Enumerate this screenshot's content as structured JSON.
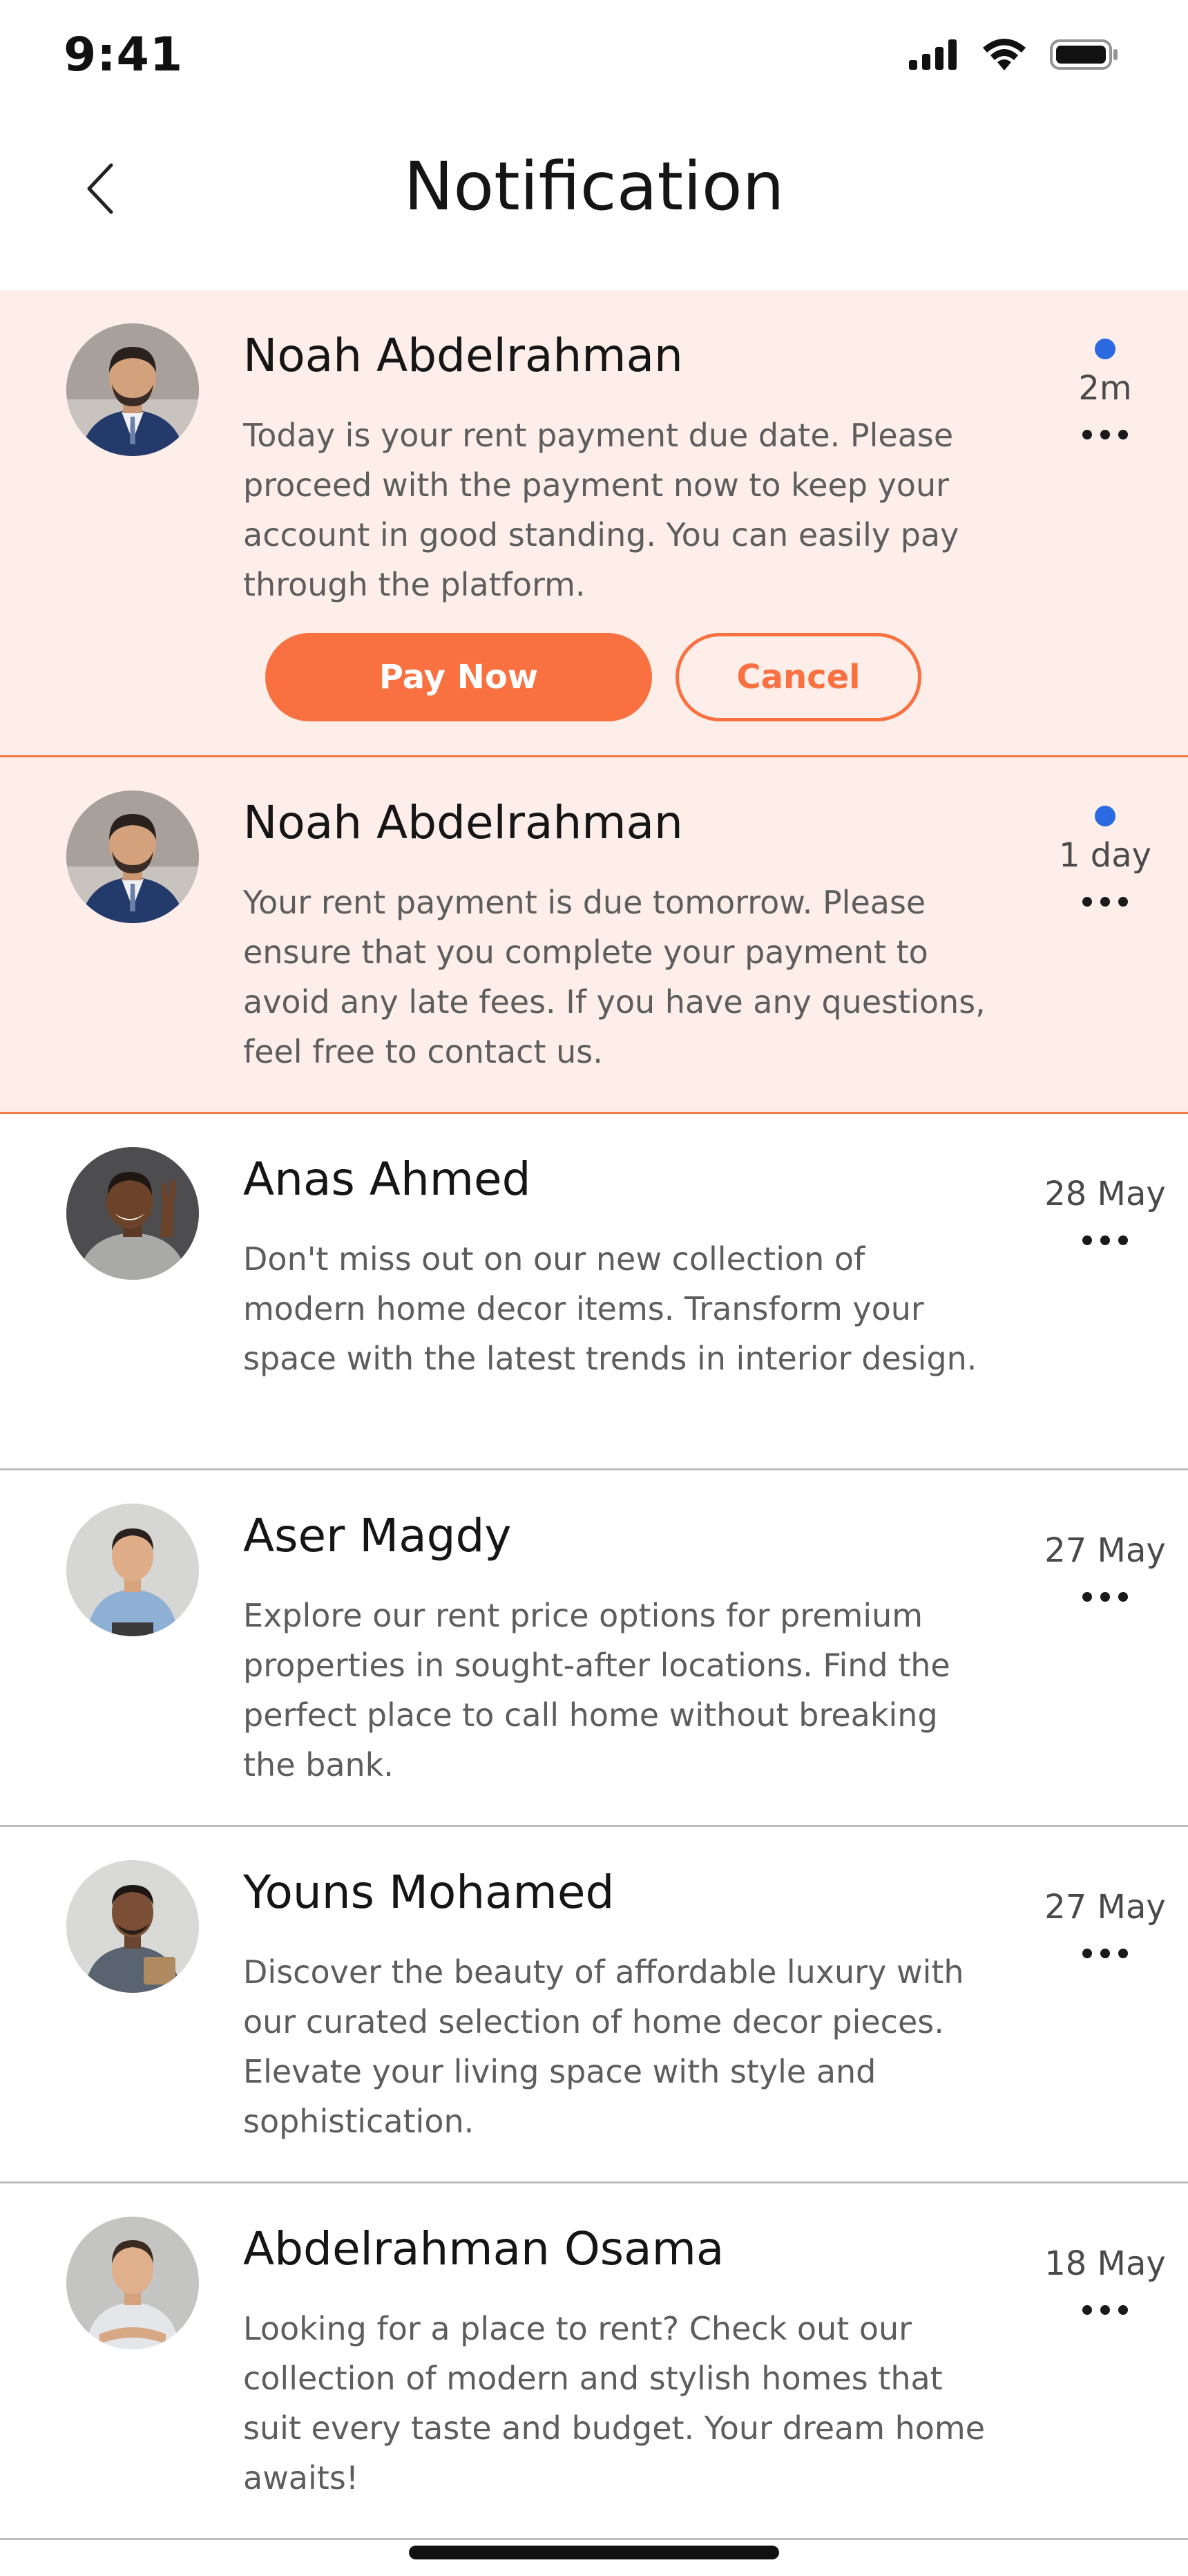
{
  "status_bar": {
    "time": "9:41",
    "icons": [
      "signal-icon",
      "wifi-icon",
      "battery-icon"
    ]
  },
  "header": {
    "title": "Notification",
    "back_icon": "chevron-left-icon"
  },
  "colors": {
    "accent": "#f97140",
    "unread_bg": "#fdeee9",
    "unread_dot": "#2b6ae0",
    "divider": "#bdbdbd"
  },
  "notifications": [
    {
      "name": "Noah Abdelrahman",
      "message": "Today is your rent payment due date. Please proceed with the payment now to keep your account in good standing. You can easily pay through the platform.",
      "time": "2m",
      "unread": true,
      "primary_action": "Pay Now",
      "secondary_action": "Cancel"
    },
    {
      "name": "Noah Abdelrahman",
      "message": "Your rent payment is due tomorrow. Please ensure that you complete your payment to avoid any late fees. If you have any questions, feel free to contact us.",
      "time": "1 day",
      "unread": true
    },
    {
      "name": "Anas Ahmed",
      "message": "Don't miss out on our new collection of modern home decor items. Transform your space with the latest trends in interior design.",
      "time": "28 May",
      "unread": false
    },
    {
      "name": "Aser Magdy",
      "message": "Explore our rent price options for premium properties in sought-after locations. Find the perfect place to call home without breaking the bank.",
      "time": "27 May",
      "unread": false
    },
    {
      "name": "Youns Mohamed",
      "message": "Discover the beauty of affordable luxury with our curated selection of home decor pieces. Elevate your living space with style and sophistication.",
      "time": "27 May",
      "unread": false
    },
    {
      "name": "Abdelrahman Osama",
      "message": "Looking for a place to rent? Check out our collection of modern and stylish homes that suit every taste and budget. Your dream home awaits!",
      "time": "18 May",
      "unread": false
    }
  ]
}
